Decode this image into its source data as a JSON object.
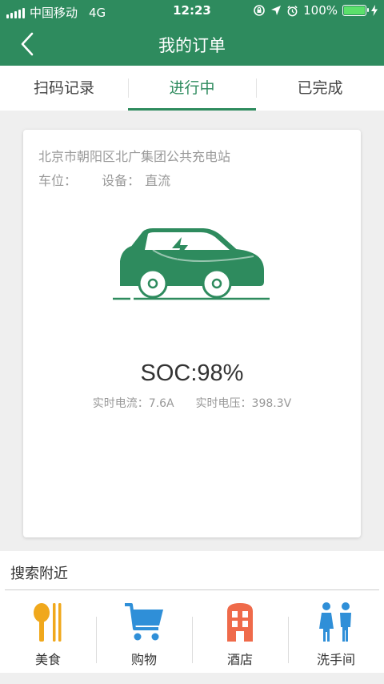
{
  "status_bar": {
    "carrier": "中国移动",
    "network": "4G",
    "time": "12:23",
    "battery_text": "100%",
    "battery_level": 1.0,
    "icons": [
      "signal-icon",
      "rotation-lock-icon",
      "location-icon",
      "alarm-icon",
      "battery-icon",
      "charging-bolt-icon"
    ]
  },
  "nav": {
    "title": "我的订单",
    "back_icon": "back-chevron-icon"
  },
  "tabs": [
    {
      "label": "扫码记录",
      "active": false
    },
    {
      "label": "进行中",
      "active": true
    },
    {
      "label": "已完成",
      "active": false
    }
  ],
  "order": {
    "station": "北京市朝阳区北广集团公共充电站",
    "parking_label": "车位：",
    "parking_value": "",
    "device_label": "设备：",
    "device_value": "直流",
    "car_icon": "charging-car-icon",
    "soc_text": "SOC:98%",
    "current_label": "实时电流：",
    "current_value": "7.6A",
    "voltage_label": "实时电压：",
    "voltage_value": "398.3V"
  },
  "nearby": {
    "title": "搜索附近",
    "categories": [
      {
        "label": "美食",
        "icon": "fork-spoon-icon"
      },
      {
        "label": "购物",
        "icon": "shopping-cart-icon"
      },
      {
        "label": "酒店",
        "icon": "hotel-door-icon"
      },
      {
        "label": "洗手间",
        "icon": "restroom-icon"
      }
    ]
  },
  "colors": {
    "primary": "#2e8b5e",
    "food": "#f0a81c",
    "shopping": "#2f8fd8",
    "hotel": "#ef6a4a",
    "restroom": "#2f8fd8"
  }
}
